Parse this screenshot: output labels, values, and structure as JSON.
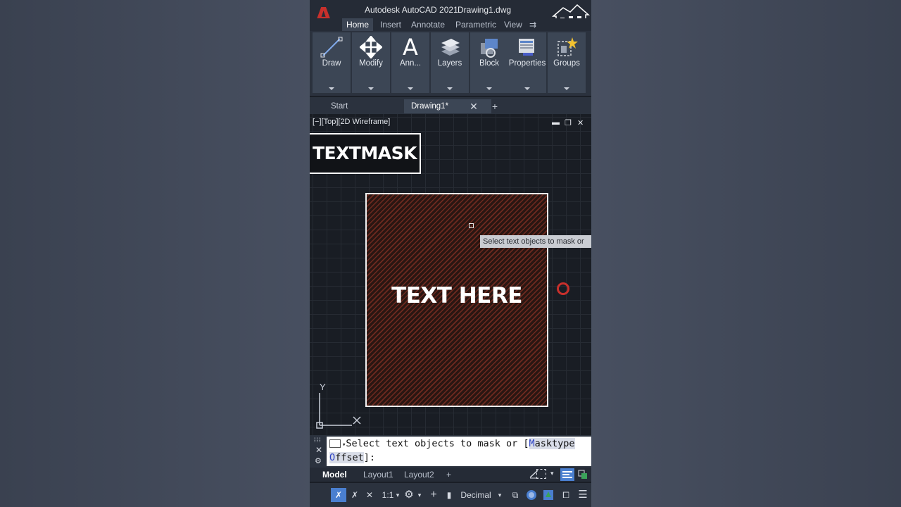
{
  "titlebar": {
    "app_title": "Autodesk AutoCAD 2021",
    "document_title": "Drawing1.dwg",
    "logo_letter": "A"
  },
  "ribbon_tabs": [
    "Home",
    "Insert",
    "Annotate",
    "Parametric",
    "View"
  ],
  "ribbon_tab_more": "⇉",
  "ribbon_panels": [
    {
      "label": "Draw",
      "icon": "line-icon"
    },
    {
      "label": "Modify",
      "icon": "move-icon"
    },
    {
      "label": "Ann...",
      "icon": "text-a-icon"
    },
    {
      "label": "Layers",
      "icon": "layers-icon"
    },
    {
      "label": "Block",
      "icon": "block-icon"
    },
    {
      "label": "Properties",
      "icon": "properties-icon"
    },
    {
      "label": "Groups",
      "icon": "groups-icon"
    }
  ],
  "doc_tabs": {
    "start": "Start",
    "drawing": "Drawing1*",
    "close": "✕",
    "add": "+"
  },
  "viewport": {
    "view_label": "[−][Top][2D Wireframe]",
    "controls": {
      "minimize": "▬",
      "restore": "❐",
      "close": "✕"
    },
    "overlay_title": "TEXTMASK",
    "sample_text": "TEXT HERE",
    "tooltip": "Select text objects to mask or",
    "ucs": {
      "y": "Y",
      "x": "X"
    }
  },
  "command_line": {
    "line1_prefix": "Select text objects to mask or [",
    "opt1_hot": "M",
    "opt1_rest": "asktype",
    "line2_opt_hot": "O",
    "line2_opt_rest": "ffset",
    "line2_suffix": "]:"
  },
  "layout_tabs": {
    "model": "Model",
    "layout1": "Layout1",
    "layout2": "Layout2",
    "add": "+"
  },
  "statusbar": {
    "scale": "1:1",
    "units": "Decimal"
  },
  "colors": {
    "accent_red": "#c8302c",
    "mask_hatch": "#6e2a20",
    "panel_bg": "#3c4655"
  }
}
